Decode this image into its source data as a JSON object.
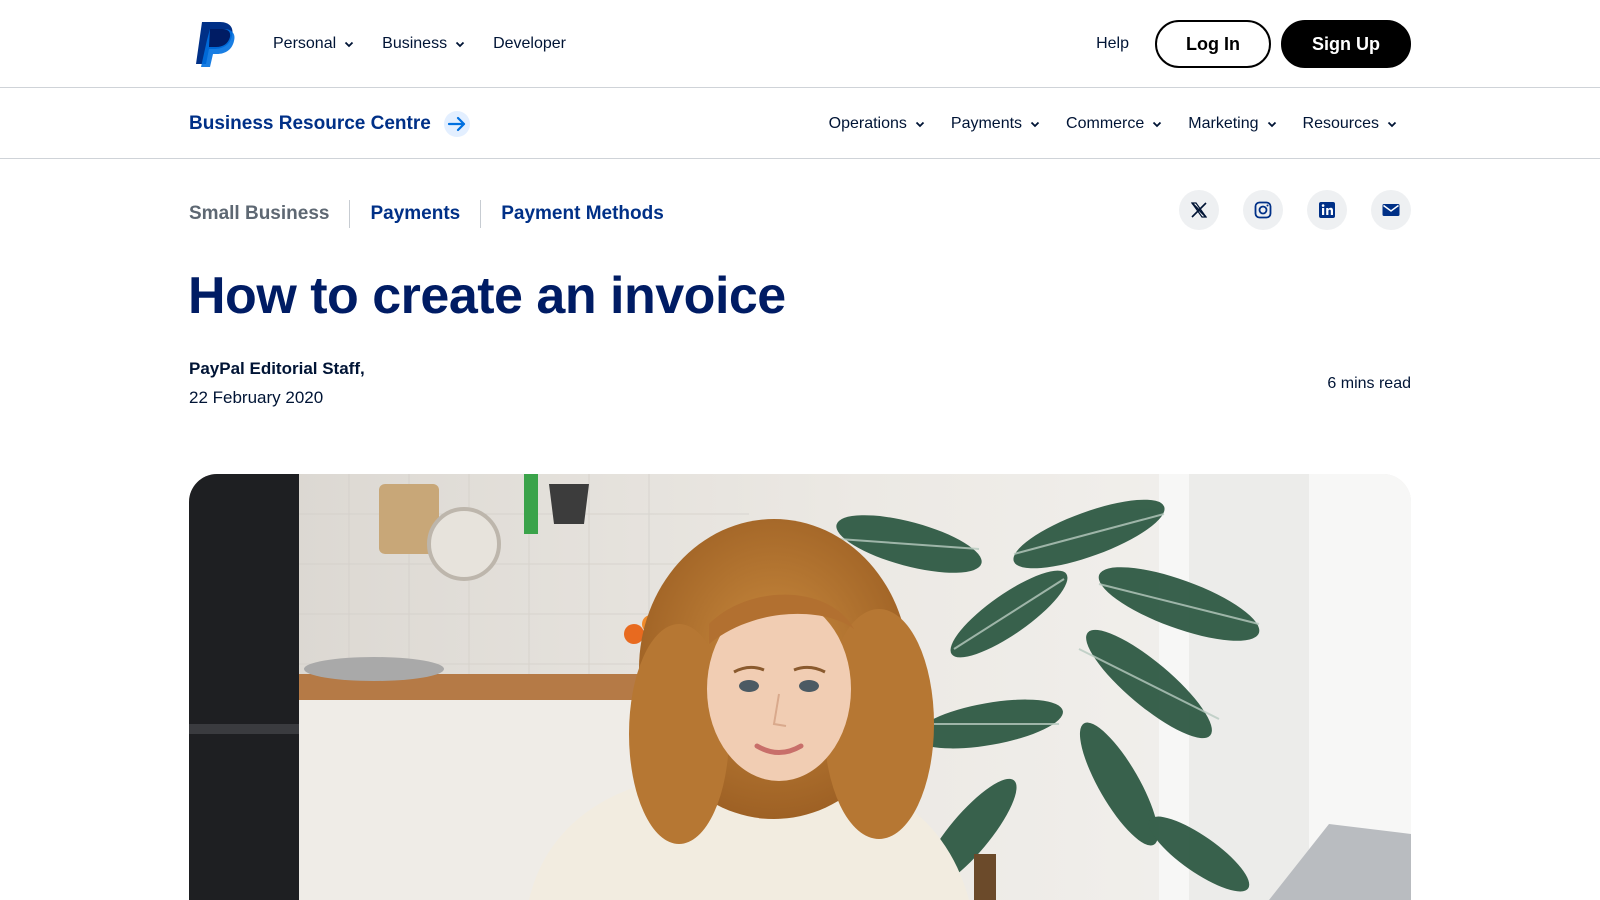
{
  "header": {
    "nav": [
      {
        "label": "Personal",
        "has_dropdown": true
      },
      {
        "label": "Business",
        "has_dropdown": true
      },
      {
        "label": "Developer",
        "has_dropdown": false
      }
    ],
    "help_label": "Help",
    "login_label": "Log In",
    "signup_label": "Sign Up"
  },
  "subnav": {
    "brand_label": "Business Resource Centre",
    "items": [
      {
        "label": "Operations"
      },
      {
        "label": "Payments"
      },
      {
        "label": "Commerce"
      },
      {
        "label": "Marketing"
      },
      {
        "label": "Resources"
      }
    ]
  },
  "breadcrumb": [
    "Small Business",
    "Payments",
    "Payment Methods"
  ],
  "social": [
    "x-icon",
    "instagram-icon",
    "linkedin-icon",
    "mail-icon"
  ],
  "article": {
    "title": "How to create an invoice",
    "author": "PayPal Editorial Staff,",
    "date": "22 February 2020",
    "read_time": "6 mins read"
  },
  "colors": {
    "brand_navy": "#003087",
    "headline_navy": "#001c64",
    "text": "#001435",
    "accent_blue": "#0070e0",
    "button_black": "#000000"
  }
}
